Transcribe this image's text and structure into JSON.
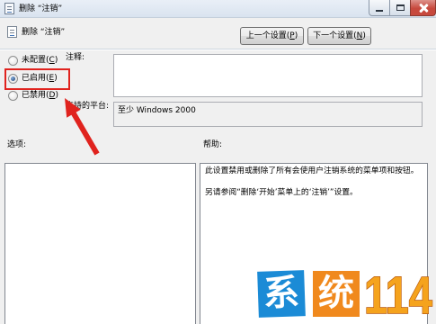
{
  "window": {
    "title": "删除 “注销”",
    "app_icon": "group-policy-icon",
    "controls": [
      "minimize-icon",
      "maximize-icon",
      "close-icon"
    ],
    "close_color": "#c7493d"
  },
  "header": {
    "policy_title": "删除 “注销”",
    "policy_icon": "policy-setting-icon",
    "prev_button": {
      "text": "上一个设置(",
      "accel": "P",
      "after": ")"
    },
    "next_button": {
      "text": "下一个设置(",
      "accel": "N",
      "after": ")"
    }
  },
  "state_options": [
    {
      "text": "未配置(",
      "accel": "C",
      "after": ")",
      "selected": false
    },
    {
      "text": "已启用(",
      "accel": "E",
      "after": ")",
      "selected": true
    },
    {
      "text": "已禁用(",
      "accel": "D",
      "after": ")",
      "selected": false
    }
  ],
  "comment": {
    "label": "注释:",
    "value": ""
  },
  "supported_platform": {
    "label": "支持的平台:",
    "value": "至少 Windows 2000"
  },
  "options_pane": {
    "label": "选项:"
  },
  "help_pane": {
    "label": "帮助:",
    "paragraphs": [
      "此设置禁用或删除了所有会使用户注销系统的菜单项和按钮。",
      "另请参阅“删除‘开始’菜单上的‘注销’”设置。"
    ]
  },
  "annotation": {
    "color": "#e0231e"
  },
  "watermark": {
    "char1": "系",
    "char2": "统",
    "number": "114",
    "blue": "#1b8bd6",
    "orange": "#f0891d",
    "number_color": "#f5a31d"
  }
}
